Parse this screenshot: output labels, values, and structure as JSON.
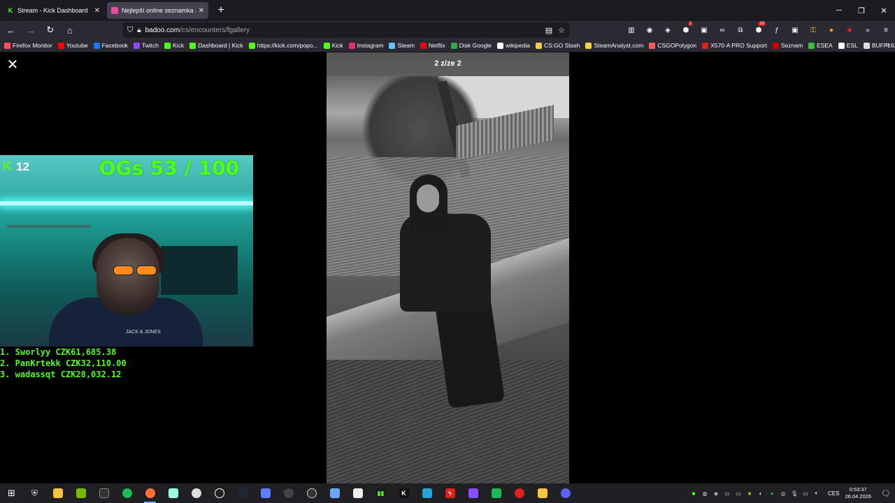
{
  "browser": {
    "tabs": [
      {
        "title": "Stream - Kick Dashboard",
        "favicon": "kick-icon",
        "color": "#53fc18"
      },
      {
        "title": "Nejlepší online seznamka zdarm",
        "favicon": "badoo-icon",
        "color": "#e94ba0"
      }
    ],
    "url_domain": "badoo.com",
    "url_path": "/cs/encounters/fgallery",
    "extension_badges": {
      "ext1": "1",
      "ext2": "19"
    }
  },
  "bookmarks": [
    {
      "label": "Firefox Monitor",
      "icon": "firefox-monitor-icon",
      "color": "#ff4f5e"
    },
    {
      "label": "Youtube",
      "icon": "youtube-icon",
      "color": "#ff0000"
    },
    {
      "label": "Facebook",
      "icon": "facebook-icon",
      "color": "#1877f2"
    },
    {
      "label": "Twitch",
      "icon": "twitch-icon",
      "color": "#9146ff"
    },
    {
      "label": "Kick",
      "icon": "kick-icon",
      "color": "#53fc18"
    },
    {
      "label": "Dashboard | Kick",
      "icon": "kick-icon",
      "color": "#53fc18"
    },
    {
      "label": "https://kick.com/popo...",
      "icon": "kick-icon",
      "color": "#53fc18"
    },
    {
      "label": "Kick",
      "icon": "kick-icon",
      "color": "#53fc18"
    },
    {
      "label": "Instagram",
      "icon": "instagram-icon",
      "color": "#e1306c"
    },
    {
      "label": "Steam",
      "icon": "steam-icon",
      "color": "#66c0f4"
    },
    {
      "label": "Netflix",
      "icon": "netflix-icon",
      "color": "#e50914"
    },
    {
      "label": "Disk Google",
      "icon": "google-drive-icon",
      "color": "#34a853"
    },
    {
      "label": "wikipedia",
      "icon": "wikipedia-icon",
      "color": "#ffffff"
    },
    {
      "label": "CS:GO Stash",
      "icon": "csgostash-icon",
      "color": "#f2c94c"
    },
    {
      "label": "SteamAnalyst.com",
      "icon": "steamanalyst-icon",
      "color": "#f5d142"
    },
    {
      "label": "CSGOPolygon",
      "icon": "csgopolygon-icon",
      "color": "#ff5b5b"
    },
    {
      "label": "X570-A PRO Support",
      "icon": "msi-icon",
      "color": "#e0201b"
    },
    {
      "label": "Seznam",
      "icon": "seznam-icon",
      "color": "#cc0000"
    },
    {
      "label": "ESEA",
      "icon": "esea-icon",
      "color": "#3fbf3f"
    },
    {
      "label": "ESL",
      "icon": "esl-icon",
      "color": "#ffffff"
    },
    {
      "label": "BUFF163",
      "icon": "buff-icon",
      "color": "#dddddd"
    }
  ],
  "stream_overlay": {
    "viewer_count": "12",
    "goal_text": "OGs 53 / 100",
    "shirt_text": "JACK & JONES",
    "leaderboard": [
      "1. Sworlyy CZK61,685.38",
      "2. PanKrtekk CZK32,110.00",
      "3. wadassqt CZK28,032.12"
    ]
  },
  "gallery": {
    "counter": "2 z/ze 2"
  },
  "taskbar": {
    "language": "CES",
    "time": "0:53:37",
    "date": "26.04.2026"
  },
  "colors": {
    "kick_green": "#53fc18",
    "tab_active_bg": "#42414d",
    "toolbar_bg": "#2b2a33"
  }
}
